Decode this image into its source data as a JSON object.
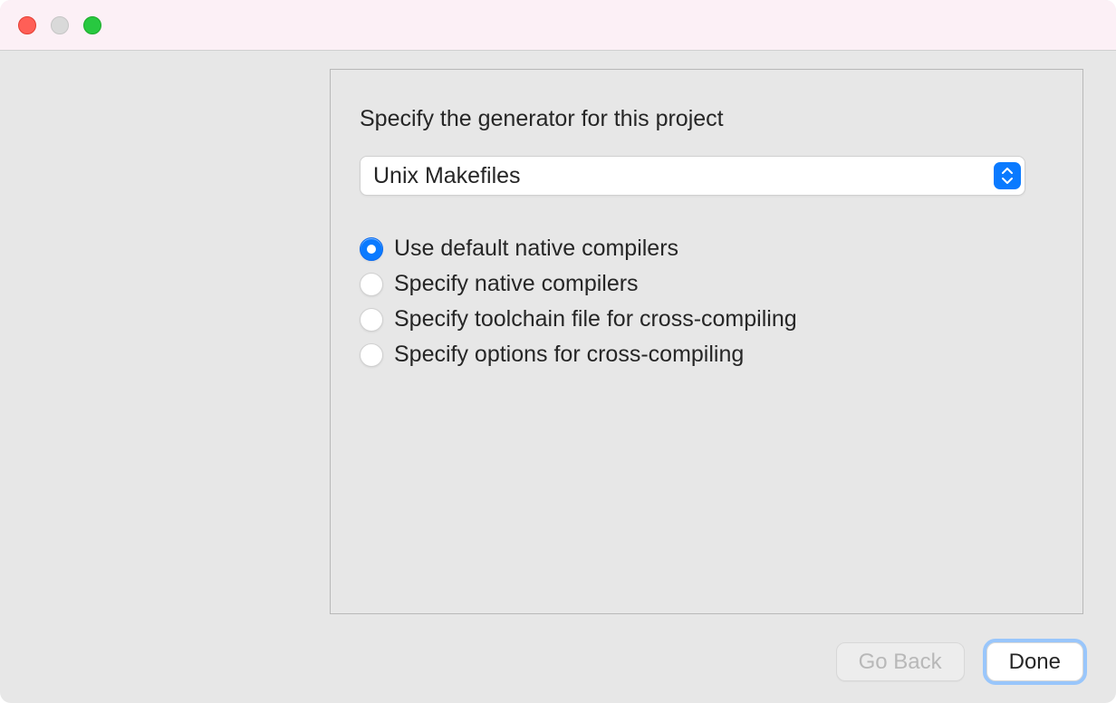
{
  "dialog": {
    "title": "Specify the generator for this project",
    "dropdown": {
      "selected": "Unix Makefiles"
    },
    "radioOptions": [
      {
        "label": "Use default native compilers",
        "selected": true
      },
      {
        "label": "Specify native compilers",
        "selected": false
      },
      {
        "label": "Specify toolchain file for cross-compiling",
        "selected": false
      },
      {
        "label": "Specify options for cross-compiling",
        "selected": false
      }
    ],
    "buttons": {
      "goBack": "Go Back",
      "done": "Done"
    }
  }
}
